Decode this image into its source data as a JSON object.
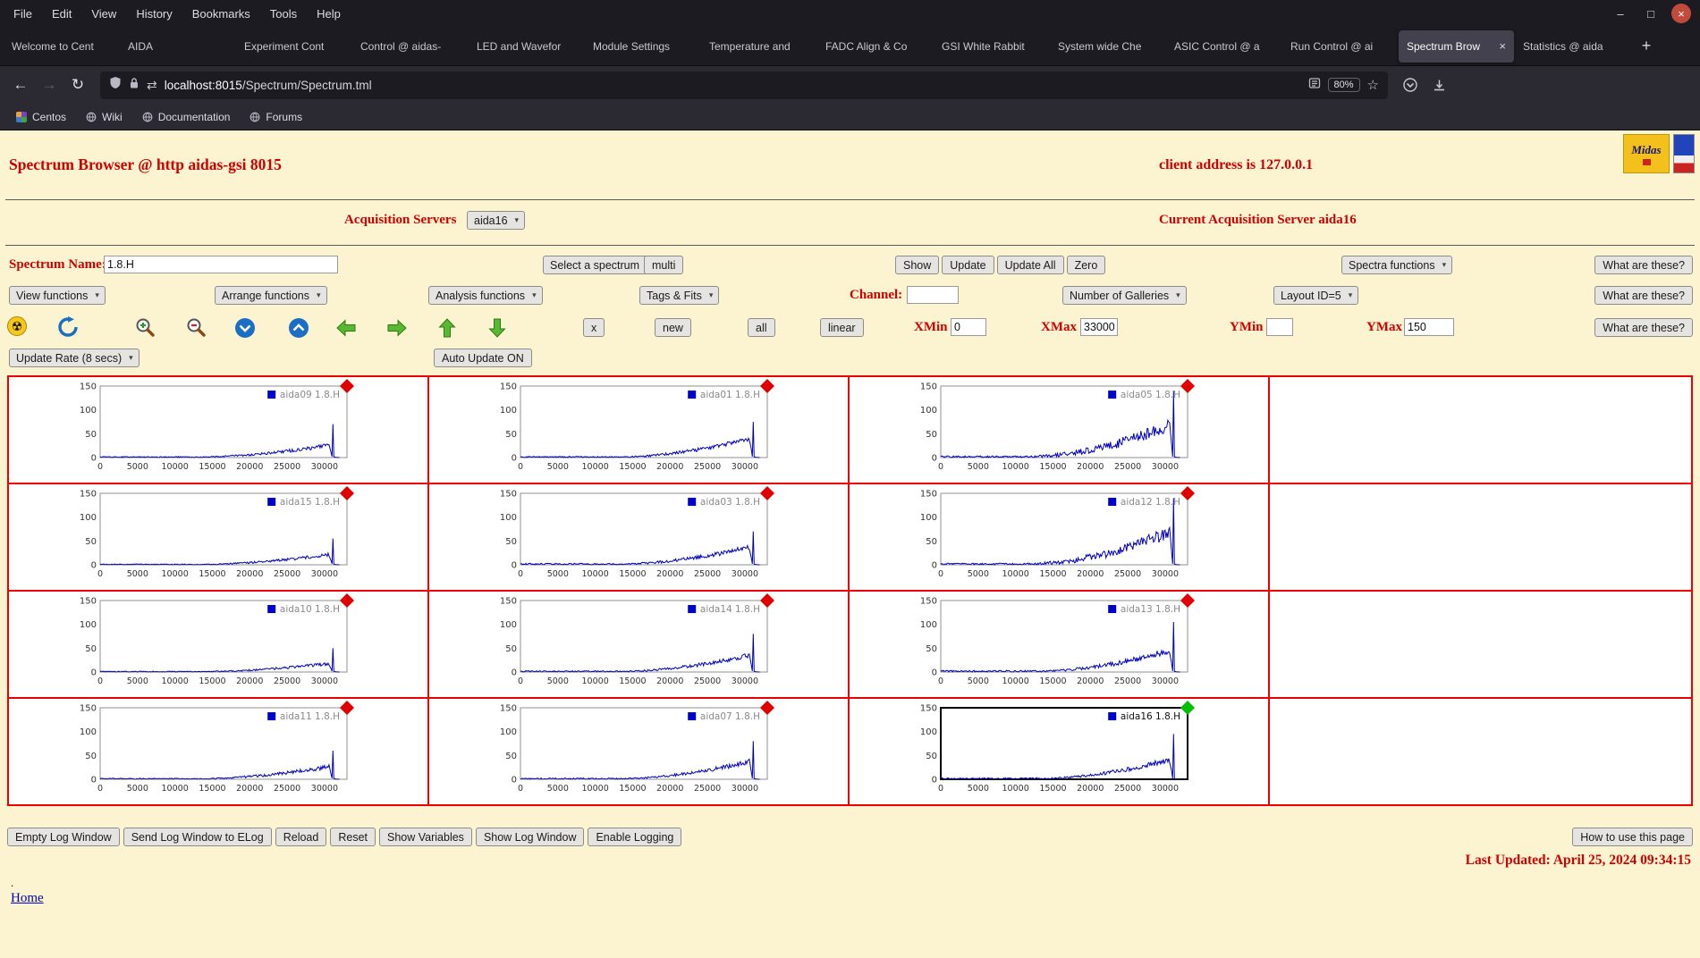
{
  "window": {
    "menu": [
      "File",
      "Edit",
      "View",
      "History",
      "Bookmarks",
      "Tools",
      "Help"
    ]
  },
  "icons": {
    "minimize": "–",
    "maximize": "□",
    "close": "×",
    "back": "←",
    "forward": "→",
    "reload": "↻",
    "swap": "⇄",
    "star": "☆",
    "radiation": "☢",
    "select_arrow": "▾",
    "tab_close": "×"
  },
  "tabs": {
    "items": [
      "Welcome to Cent",
      "AIDA",
      "Experiment Cont",
      "Control @ aidas-",
      "LED and Wavefor",
      "Module Settings",
      "Temperature and",
      "FADC Align & Co",
      "GSI White Rabbit",
      "System wide Che",
      "ASIC Control @ a",
      "Run Control @ ai",
      "Spectrum Brow",
      "Statistics @ aida"
    ],
    "active_index": 12,
    "new_tab_label": "+"
  },
  "nav": {
    "url_host": "localhost:8015",
    "url_path": "/Spectrum/Spectrum.tml",
    "zoom": "80%"
  },
  "bookmarks": [
    "Centos",
    "Wiki",
    "Documentation",
    "Forums"
  ],
  "header": {
    "title": "Spectrum Browser @ http aidas-gsi 8015",
    "client": "client address is 127.0.0.1",
    "midas_logo_text": "Midas"
  },
  "acquisition": {
    "label": "Acquisition Servers",
    "server": "aida16",
    "current": "Current Acquisition Server aida16"
  },
  "controls": {
    "spectrum_name_label": "Spectrum Name:",
    "spectrum_name_value": "1.8.H",
    "select_spectrum": "Select a spectrum",
    "multi": "multi",
    "show": "Show",
    "update": "Update",
    "update_all": "Update All",
    "zero": "Zero",
    "spectra_functions": "Spectra functions",
    "what_are_these": "What are these?",
    "view_functions": "View functions",
    "arrange_functions": "Arrange functions",
    "analysis_functions": "Analysis functions",
    "tags_fits": "Tags & Fits",
    "channel_label": "Channel:",
    "channel_value": "",
    "number_of_galleries": "Number of Galleries",
    "layout_id": "Layout ID=5",
    "x_button": "x",
    "new_button": "new",
    "all_button": "all",
    "linear_button": "linear",
    "xmin_label": "XMin",
    "xmin_value": "0",
    "xmax_label": "XMax",
    "xmax_value": "33000",
    "ymin_label": "YMin",
    "ymin_value": "",
    "ymax_label": "YMax",
    "ymax_value": "150",
    "update_rate": "Update Rate (8 secs)",
    "auto_update": "Auto Update ON"
  },
  "footer": {
    "buttons": [
      "Empty Log Window",
      "Send Log Window to ELog",
      "Reload",
      "Reset",
      "Show Variables",
      "Show Log Window",
      "Enable Logging"
    ],
    "help_button": "How to use this page",
    "last_updated": "Last Updated: April 25, 2024 09:34:15",
    "dot": ".",
    "home_link": "Home"
  },
  "chart_data": {
    "type": "line",
    "x_ticks": [
      0,
      5000,
      10000,
      15000,
      20000,
      25000,
      30000
    ],
    "y_ticks": [
      0,
      50,
      100,
      150
    ],
    "xlim": [
      0,
      33000
    ],
    "ylim": [
      0,
      150
    ],
    "line_color": "#0000bb",
    "legend_marker_color": "#0000cc",
    "marker_color": "#e00000",
    "selected_marker_color": "#00c000",
    "grid_rows": 4,
    "grid_cols": 4,
    "plots": [
      {
        "label": "aida09 1.8.H",
        "rise": 22,
        "spike": 70,
        "noise": 5,
        "selected": false
      },
      {
        "label": "aida01 1.8.H",
        "rise": 35,
        "spike": 75,
        "noise": 6,
        "selected": false
      },
      {
        "label": "aida05 1.8.H",
        "rise": 55,
        "spike": 140,
        "noise": 16,
        "selected": false
      },
      {
        "label": "aida15 1.8.H",
        "rise": 18,
        "spike": 55,
        "noise": 4,
        "selected": false
      },
      {
        "label": "aida03 1.8.H",
        "rise": 30,
        "spike": 70,
        "noise": 7,
        "selected": false
      },
      {
        "label": "aida12 1.8.H",
        "rise": 55,
        "spike": 140,
        "noise": 16,
        "selected": false
      },
      {
        "label": "aida10 1.8.H",
        "rise": 14,
        "spike": 50,
        "noise": 4,
        "selected": false
      },
      {
        "label": "aida14 1.8.H",
        "rise": 30,
        "spike": 80,
        "noise": 6,
        "selected": false
      },
      {
        "label": "aida13 1.8.H",
        "rise": 38,
        "spike": 105,
        "noise": 8,
        "selected": false
      },
      {
        "label": "aida11 1.8.H",
        "rise": 22,
        "spike": 60,
        "noise": 5,
        "selected": false
      },
      {
        "label": "aida07 1.8.H",
        "rise": 32,
        "spike": 80,
        "noise": 6,
        "selected": false
      },
      {
        "label": "aida16 1.8.H",
        "rise": 35,
        "spike": 95,
        "noise": 7,
        "selected": true
      }
    ]
  }
}
